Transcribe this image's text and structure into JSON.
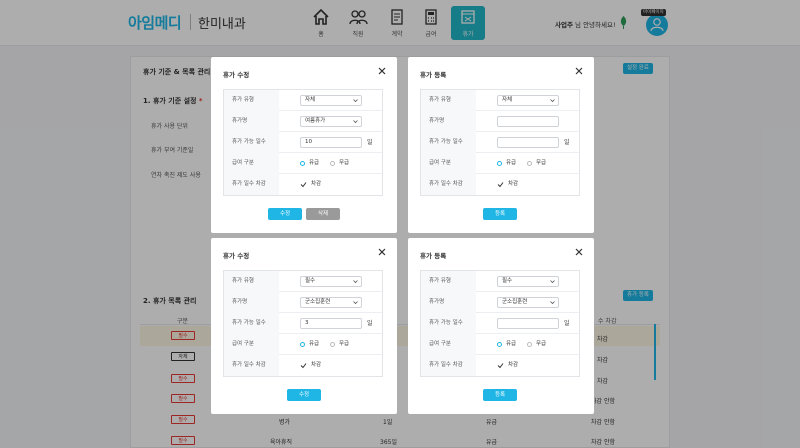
{
  "header": {
    "logo": "아임메디",
    "clinic": "한미내과",
    "nav": [
      {
        "label": "홈",
        "icon": "home-icon"
      },
      {
        "label": "직원",
        "icon": "users-icon"
      },
      {
        "label": "계약",
        "icon": "document-icon"
      },
      {
        "label": "급여",
        "icon": "calculator-icon"
      },
      {
        "label": "휴가",
        "icon": "calendar-icon",
        "active": true
      }
    ],
    "user_name": "사업주",
    "user_greeting": "님 안녕하세요!",
    "avatar_badge": "마이페이지",
    "accent": "#1fb6e6",
    "active_nav_color": "#21b7c8"
  },
  "background": {
    "title": "휴가 기준 & 목록 관리",
    "settings_button": "설정 완료",
    "section1": "1. 휴가 기준 설정",
    "section1_req": "*",
    "labels": [
      "휴가 사용 단위",
      "휴가 부여 기준일",
      "연차 촉진 제도 사용"
    ],
    "section2": "2. 휴가 목록 관리",
    "register_button": "휴가 등록",
    "col_division": "구분",
    "tags": [
      {
        "text": "필수",
        "style": "red"
      },
      {
        "text": "자체",
        "style": "blk"
      },
      {
        "text": "필수",
        "style": "red"
      },
      {
        "text": "필수",
        "style": "red"
      },
      {
        "text": "필수",
        "style": "red"
      },
      {
        "text": "필수",
        "style": "red"
      }
    ],
    "right_cells": [
      "차감",
      "차감",
      "차감",
      "차감 안함",
      "차감 안함"
    ],
    "right_header": "수 차감",
    "bottom_rows": [
      {
        "name": "병가",
        "days": "1일",
        "pay": "유급",
        "deduct": "차감 안함"
      },
      {
        "name": "육아휴직",
        "days": "365일",
        "pay": "유급",
        "deduct": "차감 안함"
      }
    ]
  },
  "modals": [
    {
      "title": "휴가 수정",
      "type_label": "휴가 유형",
      "type_value": "자체",
      "name_label": "휴가명",
      "name_value": "여름휴가",
      "name_is_select": true,
      "days_label": "휴가 가능 일수",
      "days_value": "10",
      "days_unit": "일",
      "pay_label": "급여 구분",
      "pay_on": "유급",
      "pay_off": "무급",
      "deduct_label": "휴가 일수 차감",
      "deduct_text": "차감",
      "buttons": [
        {
          "label": "수정",
          "style": "primary"
        },
        {
          "label": "삭제",
          "style": "gray"
        }
      ]
    },
    {
      "title": "휴가 등록",
      "type_label": "휴가 유형",
      "type_value": "자체",
      "name_label": "휴가명",
      "name_value": "",
      "name_is_select": false,
      "days_label": "휴가 가능 일수",
      "days_value": "",
      "days_unit": "일",
      "pay_label": "급여 구분",
      "pay_on": "유급",
      "pay_off": "무급",
      "deduct_label": "휴가 일수 차감",
      "deduct_text": "차감",
      "buttons": [
        {
          "label": "등록",
          "style": "primary"
        }
      ]
    },
    {
      "title": "휴가 수정",
      "type_label": "휴가 유형",
      "type_value": "필수",
      "name_label": "휴가명",
      "name_value": "군소집훈련",
      "name_is_select": true,
      "days_label": "휴가 가능 일수",
      "days_value": "3",
      "days_unit": "일",
      "pay_label": "급여 구분",
      "pay_on": "유급",
      "pay_off": "무급",
      "deduct_label": "휴가 일수 차감",
      "deduct_text": "차감",
      "buttons": [
        {
          "label": "수정",
          "style": "primary"
        }
      ]
    },
    {
      "title": "휴가 등록",
      "type_label": "휴가 유형",
      "type_value": "필수",
      "name_label": "휴가명",
      "name_value": "군소집훈련",
      "name_is_select": true,
      "days_label": "휴가 가능 일수",
      "days_value": "",
      "days_unit": "일",
      "pay_label": "급여 구분",
      "pay_on": "유급",
      "pay_off": "무급",
      "deduct_label": "휴가 일수 차감",
      "deduct_text": "차감",
      "buttons": [
        {
          "label": "등록",
          "style": "primary"
        }
      ]
    }
  ]
}
